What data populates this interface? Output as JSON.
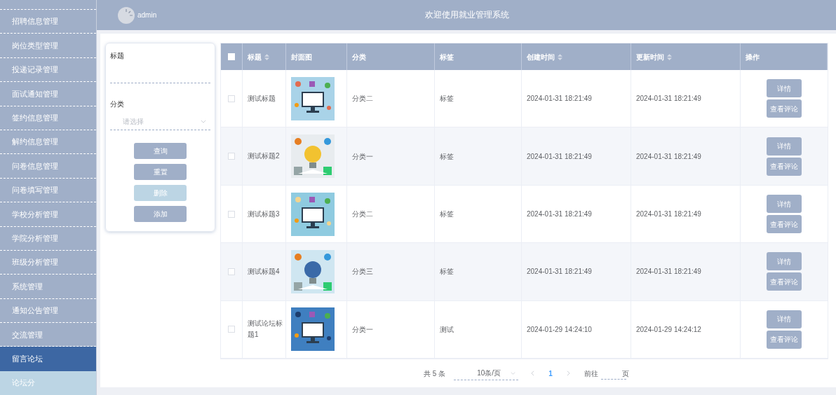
{
  "header": {
    "username": "admin",
    "title": "欢迎使用就业管理系统"
  },
  "sidebar": {
    "items": [
      {
        "label": "招聘信息管理",
        "selected": false
      },
      {
        "label": "岗位类型管理",
        "selected": false
      },
      {
        "label": "投递记录管理",
        "selected": false
      },
      {
        "label": "面试通知管理",
        "selected": false
      },
      {
        "label": "签约信息管理",
        "selected": false
      },
      {
        "label": "解约信息管理",
        "selected": false
      },
      {
        "label": "问卷信息管理",
        "selected": false
      },
      {
        "label": "问卷填写管理",
        "selected": false
      },
      {
        "label": "学校分析管理",
        "selected": false
      },
      {
        "label": "学院分析管理",
        "selected": false
      },
      {
        "label": "班级分析管理",
        "selected": false
      },
      {
        "label": "系统管理",
        "selected": false
      },
      {
        "label": "通知公告管理",
        "selected": false
      },
      {
        "label": "交流管理",
        "selected": false
      },
      {
        "label": "留言论坛",
        "selected": true,
        "children": [
          {
            "label": "论坛分",
            "selected": false
          }
        ]
      }
    ]
  },
  "filter": {
    "fields": [
      {
        "kind": "text",
        "label": "标题"
      },
      {
        "kind": "select",
        "label": "分类",
        "placeholder": "请选择"
      }
    ],
    "buttons": [
      {
        "label": "查询",
        "disabled": false
      },
      {
        "label": "重置",
        "disabled": false
      },
      {
        "label": "删除",
        "disabled": true
      },
      {
        "label": "添加",
        "disabled": false
      }
    ]
  },
  "table": {
    "select_all": {
      "checked": false
    },
    "columns": [
      {
        "label": "标题",
        "sortable": true
      },
      {
        "label": "封面图",
        "sortable": false
      },
      {
        "label": "分类",
        "sortable": false
      },
      {
        "label": "标签",
        "sortable": false
      },
      {
        "label": "创建时间",
        "sortable": true
      },
      {
        "label": "更新时间",
        "sortable": true
      },
      {
        "label": "操作",
        "sortable": false
      }
    ],
    "rows": [
      {
        "checked": false,
        "title": "测试标题",
        "category": "分类二",
        "tag": "标签",
        "created": "2024-01-31 18:21:49",
        "updated": "2024-01-31 18:21:49",
        "actions": [
          "详情",
          "查看评论"
        ]
      },
      {
        "checked": false,
        "title": "测试标题2",
        "category": "分类一",
        "tag": "标签",
        "created": "2024-01-31 18:21:49",
        "updated": "2024-01-31 18:21:49",
        "actions": [
          "详情",
          "查看评论"
        ]
      },
      {
        "checked": false,
        "title": "测试标题3",
        "category": "分类二",
        "tag": "标签",
        "created": "2024-01-31 18:21:49",
        "updated": "2024-01-31 18:21:49",
        "actions": [
          "详情",
          "查看评论"
        ]
      },
      {
        "checked": false,
        "title": "测试标题4",
        "category": "分类三",
        "tag": "标签",
        "created": "2024-01-31 18:21:49",
        "updated": "2024-01-31 18:21:49",
        "actions": [
          "详情",
          "查看评论"
        ]
      },
      {
        "checked": false,
        "title": "测试论坛标题1",
        "category": "分类一",
        "tag": "测试",
        "created": "2024-01-29 14:24:10",
        "updated": "2024-01-29 14:24:12",
        "actions": [
          "详情",
          "查看评论"
        ]
      }
    ]
  },
  "pagination": {
    "total": "共 5 条",
    "page_size": "10条/页",
    "pages": [
      {
        "label": "1",
        "selected": true
      }
    ],
    "goto_label": "前往",
    "goto_suffix": "页"
  }
}
